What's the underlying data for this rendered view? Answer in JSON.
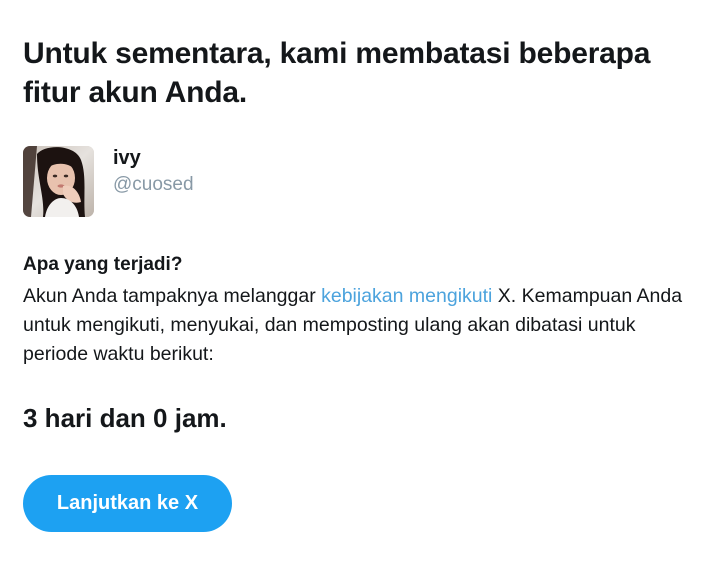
{
  "title": "Untuk sementara, kami membatasi beberapa fitur akun Anda.",
  "profile": {
    "name": "ivy",
    "handle": "@cuosed"
  },
  "section": {
    "heading": "Apa yang terjadi?",
    "text_before_link": "Akun Anda tampaknya melanggar ",
    "link_text": "kebijakan mengikuti",
    "text_after_link": " X. Kemampuan Anda untuk mengikuti, menyukai, dan memposting ulang akan dibatasi untuk periode waktu berikut:"
  },
  "duration": "3 hari dan 0 jam.",
  "continue_button_label": "Lanjutkan ke X",
  "colors": {
    "link": "#4ca3dd",
    "button": "#1da1f2",
    "handle": "#8899a6",
    "text": "#14171a"
  }
}
